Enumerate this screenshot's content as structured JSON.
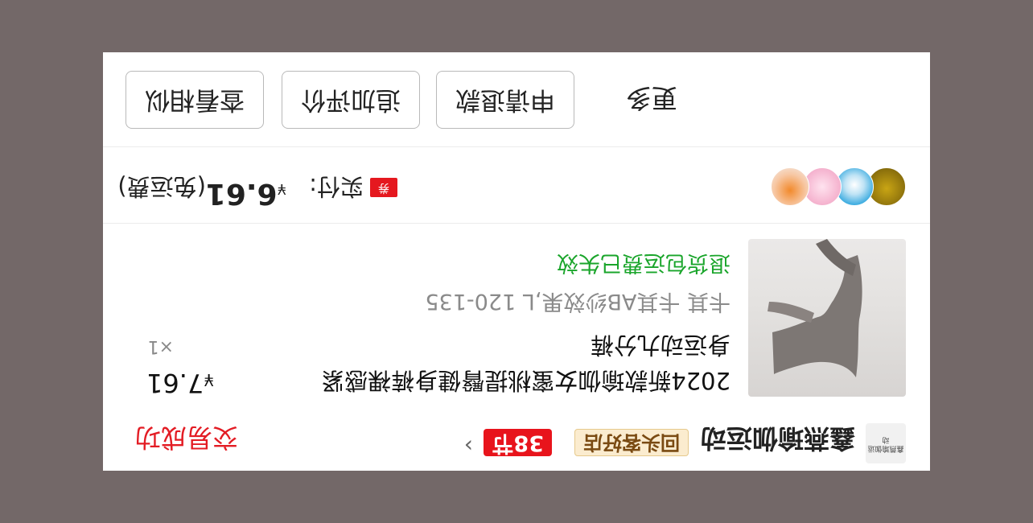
{
  "shop": {
    "logo_text": "鑫燕瑜伽运动",
    "name": "鑫燕瑜伽运动",
    "return_badge": "回头客好店",
    "discount_badge": "38节",
    "chevron": "›",
    "status": "交易成功"
  },
  "product": {
    "title": "2024新款瑜伽女蜜桃提臀健身裤裸感紧身运动九分裤",
    "price_symbol": "¥",
    "price": "7.61",
    "quantity": "×1",
    "spec": "卡其 卡其AB纱效果,L 120-135",
    "notice": "退货包运费已失效"
  },
  "payment": {
    "coupon_tag": "券",
    "label": "实付:",
    "symbol": "¥",
    "amount": "6.61",
    "shipping": "(免运费)"
  },
  "actions": {
    "more": "更多",
    "refund": "申请退款",
    "review": "追加评价",
    "similar": "查看相似"
  },
  "colors": {
    "background": "#736868",
    "status_red": "#e31c24",
    "notice_green": "#1aa52b",
    "badge_red": "#e8141c"
  }
}
